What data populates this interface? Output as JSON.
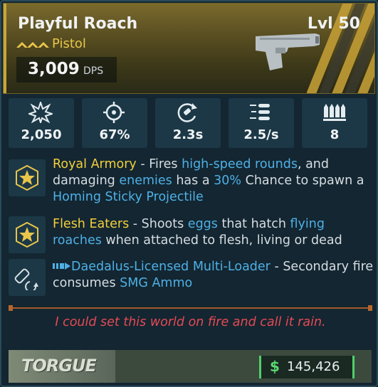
{
  "weapon": {
    "name": "Playful Roach",
    "level": "Lvl 50",
    "type": "Pistol",
    "dps_value": "3,009",
    "dps_unit": "DPS",
    "rarity_color": "#c9a53a"
  },
  "stats": [
    {
      "icon": "damage-burst-icon",
      "value": "2,050"
    },
    {
      "icon": "crosshair-accuracy-icon",
      "value": "67%"
    },
    {
      "icon": "reload-time-icon",
      "value": "2.3s"
    },
    {
      "icon": "fire-rate-icon",
      "value": "2.5/s"
    },
    {
      "icon": "magazine-ammo-icon",
      "value": "8"
    }
  ],
  "perks": [
    {
      "icon": "star-badge-icon",
      "name": "Royal Armory",
      "sep": " - ",
      "t1": "Fires ",
      "k1": "high-speed rounds",
      "t2": ", and damaging ",
      "k2": "enemies",
      "t3": " has a ",
      "k3": "30%",
      "t4": " Chance to spawn a ",
      "k4": "Homing Sticky Projectile"
    },
    {
      "icon": "star-badge-icon",
      "name": "Flesh Eaters",
      "sep": " - ",
      "t1": "Shoots ",
      "k1": "eggs",
      "t2": " that hatch ",
      "k2": "flying roaches",
      "t3": " when attached to flesh, living or dead"
    },
    {
      "icon": "multi-loader-icon",
      "name_icon": "ammo-feed-icon",
      "name": "Daedalus-Licensed Multi-Loader",
      "sep": " - ",
      "t1": "Secondary fire consumes ",
      "k1": "SMG Ammo"
    }
  ],
  "flavor_text": "I could set this world on fire and call it rain.",
  "footer": {
    "brand": "TORGUE",
    "price_symbol": "$",
    "price": "145,426"
  },
  "colors": {
    "keyword": "#4fb0e6",
    "perk_name": "#f2cf3b",
    "flavor": "#e64a55",
    "accent_orange": "#e0762d",
    "price_green": "#5ad870"
  }
}
